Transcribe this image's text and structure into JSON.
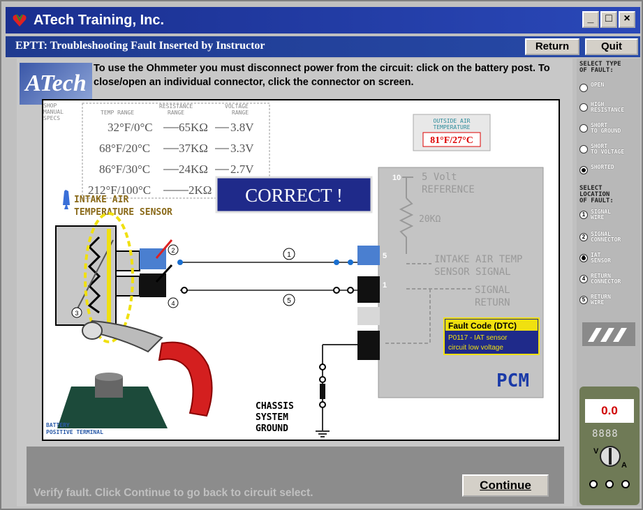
{
  "window": {
    "title": "ATech Training, Inc.",
    "minimize": "_",
    "maximize": "□",
    "close": "×"
  },
  "subheader": {
    "title": "EPTT: Troubleshooting Fault Inserted by Instructor",
    "return_label": "Return",
    "quit_label": "Quit"
  },
  "logo_text": "ATech",
  "instructions": "To use the Ohmmeter you must disconnect power from the circuit: click on the battery post. To close/open an individual connector, click the connector on screen.",
  "specs": {
    "heading": [
      "SHOP",
      "MANUAL",
      "SPECS"
    ],
    "col_temp": "TEMP RANGE",
    "col_res": [
      "RESISTANCE",
      "RANGE"
    ],
    "col_volt": [
      "VOLTAGE",
      "RANGE"
    ],
    "rows": [
      {
        "temp": "32°F/0°C",
        "res": "65KΩ",
        "volt": "3.8V"
      },
      {
        "temp": "68°F/20°C",
        "res": "37KΩ",
        "volt": "3.3V"
      },
      {
        "temp": "86°F/30°C",
        "res": "24KΩ",
        "volt": "2.7V"
      },
      {
        "temp": "212°F/100°C",
        "res": "2KΩ",
        "volt": ""
      }
    ]
  },
  "outside_air": {
    "label": [
      "OUTSIDE AIR",
      "TEMPERATURE"
    ],
    "value": "81°F/27°C"
  },
  "correct_banner": "CORRECT !",
  "sensor_label": [
    "INTAKE AIR",
    "TEMPERATURE SENSOR"
  ],
  "pcm": {
    "label": "PCM",
    "ref_pin": "10",
    "ref_label": [
      "5 Volt",
      "REFERENCE"
    ],
    "resistor": "20KΩ",
    "signal_pin": "5",
    "signal_label": [
      "INTAKE AIR TEMP",
      "SENSOR SIGNAL"
    ],
    "return_pin": "1",
    "return_label": [
      "SIGNAL",
      "RETURN"
    ]
  },
  "callouts": [
    "1",
    "2",
    "3",
    "4",
    "5"
  ],
  "dtc": {
    "title": "Fault Code (DTC)",
    "text": [
      "P0117 - IAT sensor",
      "circuit low voltage"
    ]
  },
  "chassis": [
    "CHASSIS",
    "SYSTEM",
    "GROUND"
  ],
  "battery": [
    "BATTERY",
    "POSITIVE TERMINAL"
  ],
  "status_text": "Verify fault. Click Continue to go back to circuit select.",
  "continue_label": "Continue",
  "sidebar": {
    "type_heading": [
      "SELECT TYPE",
      "OF FAULT:"
    ],
    "types": [
      {
        "label": [
          "OPEN"
        ],
        "selected": false
      },
      {
        "label": [
          "HIGH",
          "RESISTANCE"
        ],
        "selected": false
      },
      {
        "label": [
          "SHORT",
          "TO GROUND"
        ],
        "selected": false
      },
      {
        "label": [
          "SHORT",
          "TO VOLTAGE"
        ],
        "selected": false
      },
      {
        "label": [
          "SHORTED"
        ],
        "selected": true
      }
    ],
    "location_heading": [
      "SELECT",
      "LOCATION",
      "OF FAULT:"
    ],
    "locations": [
      {
        "num": "1",
        "label": [
          "SIGNAL",
          "WIRE"
        ],
        "selected": false
      },
      {
        "num": "2",
        "label": [
          "SIGNAL",
          "CONNECTOR"
        ],
        "selected": false
      },
      {
        "num": "3",
        "label": [
          "IAT",
          "SENSOR"
        ],
        "selected": true
      },
      {
        "num": "4",
        "label": [
          "RETURN",
          "CONNECTOR"
        ],
        "selected": false
      },
      {
        "num": "5",
        "label": [
          "RETURN",
          "WIRE"
        ],
        "selected": false
      }
    ],
    "meter_reading": "0.0",
    "meter_digits": "8888",
    "meter_dial": [
      "V",
      "A"
    ]
  },
  "colors": {
    "title_blue": "#1a2f8f",
    "banner_bg": "#1f2a8a",
    "pcm_gray": "#c4c4c4",
    "connector_blue": "#4a7fd0",
    "wire_red": "#cc1f1f",
    "dtc_yellow": "#f0e010"
  }
}
